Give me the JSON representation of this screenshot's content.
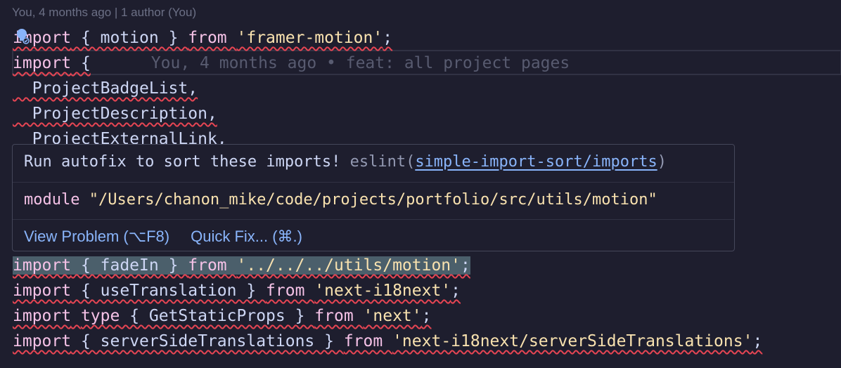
{
  "codelens": "You, 4 months ago | 1 author (You)",
  "blame_inline": "You, 4 months ago • feat: all project pages",
  "code": {
    "line1": {
      "kw1": "import",
      "mid": " { motion } ",
      "kw2": "from",
      "str": "'framer-motion'",
      "end": ";"
    },
    "line2": {
      "kw1": "import",
      "mid": " {"
    },
    "line3": "  ProjectBadgeList,",
    "line4": "  ProjectDescription,",
    "line5": "  ProjectExternalLink,",
    "line6": {
      "kw1": "import",
      "mid": " { fadeIn } ",
      "kw2": "from",
      "str": "'../../../utils/motion'",
      "end": ";"
    },
    "line7": {
      "kw1": "import",
      "mid": " { useTranslation } ",
      "kw2": "from",
      "str": "'next-i18next'",
      "end": ";"
    },
    "line8": {
      "kw1": "import",
      "kw_type": "type",
      "mid": " { GetStaticProps } ",
      "kw2": "from",
      "str": "'next'",
      "end": ";"
    },
    "line9": {
      "kw1": "import",
      "mid": " { serverSideTranslations } ",
      "kw2": "from",
      "str": "'next-i18next/serverSideTranslations'",
      "end": ";"
    }
  },
  "hover": {
    "message": "Run autofix to sort these imports!",
    "source": "eslint(",
    "rule_link": "simple-import-sort/imports",
    "source_close": ")",
    "module_kw": "module",
    "module_path": "\"/Users/chanon_mike/code/projects/portfolio/src/utils/motion\"",
    "view_problem": "View Problem (⌥F8)",
    "quick_fix": "Quick Fix... (⌘.)"
  },
  "colors": {
    "background": "#1e1e2e",
    "keyword": "#f5c2e7",
    "string": "#f9e2af",
    "link": "#89b4fa",
    "squiggle": "#e64553"
  }
}
